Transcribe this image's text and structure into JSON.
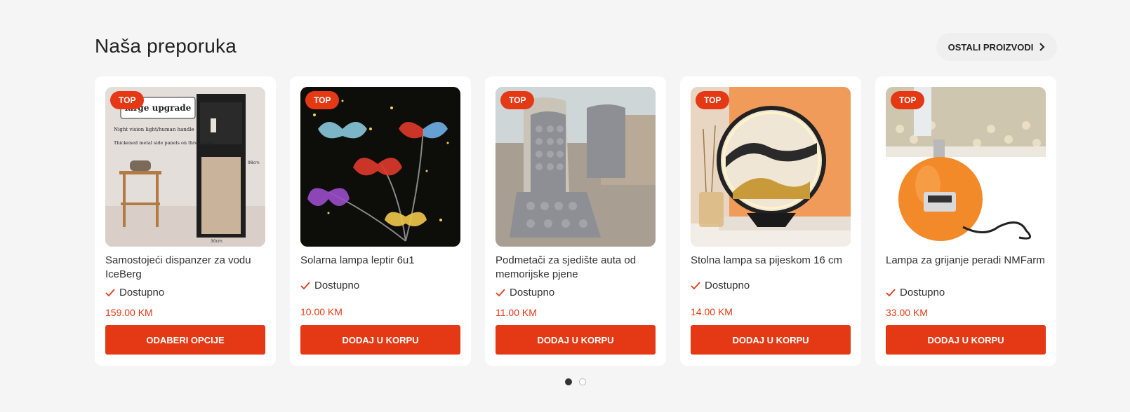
{
  "section": {
    "title": "Naša preporuka",
    "more_label": "OSTALI PROIZVODI"
  },
  "products": [
    {
      "badge": "TOP",
      "name": "Samostojeći dispanzer za vodu IceBerg",
      "stock": "Dostupno",
      "price": "159.00 KM",
      "button": "ODABERI OPCIJE",
      "image_text": [
        "large upgrade",
        "Night vision light/human handle",
        "Thickened metal side panels on three sides",
        "30cm",
        "98cm"
      ]
    },
    {
      "badge": "TOP",
      "name": "Solarna lampa leptir 6u1",
      "stock": "Dostupno",
      "price": "10.00 KM",
      "button": "DODAJ U KORPU"
    },
    {
      "badge": "TOP",
      "name": "Podmetači za sjedište auta od memorijske pjene",
      "stock": "Dostupno",
      "price": "11.00 KM",
      "button": "DODAJ U KORPU"
    },
    {
      "badge": "TOP",
      "name": "Stolna lampa sa pijeskom 16 cm",
      "stock": "Dostupno",
      "price": "14.00 KM",
      "button": "DODAJ U KORPU"
    },
    {
      "badge": "TOP",
      "name": "Lampa za grijanje peradi NMFarm",
      "stock": "Dostupno",
      "price": "33.00 KM",
      "button": "DODAJ U KORPU"
    }
  ],
  "pagination": {
    "pages": 2,
    "active": 1
  },
  "colors": {
    "accent": "#e43914",
    "background": "#f5f5f5"
  }
}
